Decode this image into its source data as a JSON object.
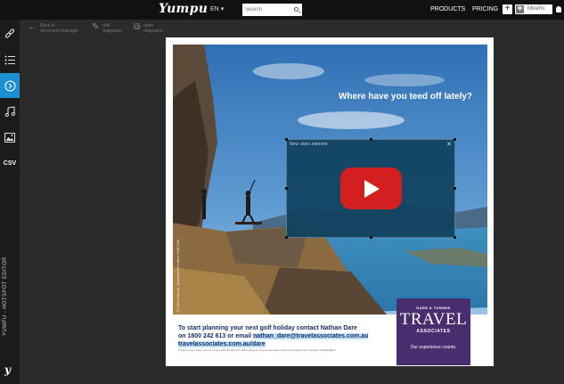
{
  "header": {
    "logo": "Yumpu",
    "language": "EN",
    "language_caret": "▾",
    "search_placeholder": "Search",
    "nav_products": "PRODUCTS",
    "nav_pricing": "PRICING",
    "plus_label": "+",
    "username": "Mikeho"
  },
  "sidebar": {
    "items": [
      {
        "icon": "link-icon",
        "glyph": "🔗"
      },
      {
        "icon": "list-icon",
        "glyph": "☰"
      },
      {
        "icon": "chevron-right-circle-icon",
        "glyph": "›"
      },
      {
        "icon": "music-icon",
        "glyph": "♫"
      },
      {
        "icon": "image-icon",
        "glyph": "▣"
      },
      {
        "icon": "csv-icon",
        "glyph": "CSV"
      }
    ],
    "vertical_label": "YUMPU - HOTSPOT EDITOR",
    "bottom_logo": "y"
  },
  "toolbar": {
    "back_line1": "Back to",
    "back_line2": "document manager",
    "edit_line1": "edit",
    "edit_line2": "magazine",
    "open_line1": "open",
    "open_line2": "magazine"
  },
  "document": {
    "headline": "Where have you teed off lately?",
    "video_label": "New video element",
    "video_close": "✕",
    "cta_line1": "To start planning your next golf holiday contact Nathan Dare",
    "cta_line2a": "on 1800 242 613 or email ",
    "cta_line2b": "nathan_dare@travelassociates.com.au",
    "cta_line3": "travelassociates.com.au/dare",
    "fineprint": "*Flight Centre Travel Group Limited ABN 25 003 377 188 trading as Travel Associates. ATAS Accreditation No. A10402. TRA8048810",
    "credit": "© Chris Gibson, Queenstown Lakes Golf Club",
    "brand_top": "DARE & TURNER",
    "brand_main": "TRAVEL",
    "brand_sub": "ASSOCIATES",
    "brand_tag": "Our experience counts."
  },
  "colors": {
    "accent": "#1a8fd1",
    "youtube_red": "#d31f1f",
    "brand_purple": "#4a2d6f",
    "cta_blue": "#1b2f6a"
  }
}
